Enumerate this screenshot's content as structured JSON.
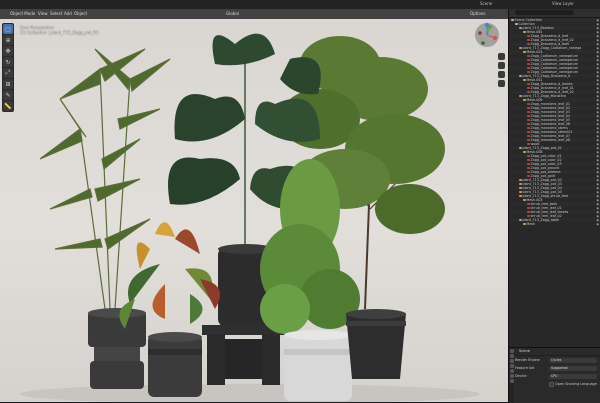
{
  "topbar": {
    "scene_label": "Scene",
    "view_layer_label": "View Layer"
  },
  "viewport": {
    "mode": "Object Mode",
    "menus": [
      "View",
      "Select",
      "Add",
      "Object"
    ],
    "transform": "Global",
    "options_label": "Options",
    "overlay_lines": [
      "User Perspective",
      "(1) Collection | plant_713_Zagg_pot_03"
    ],
    "gizmo_axes": {
      "x": "X",
      "y": "Y",
      "z": "Z"
    }
  },
  "outliner": {
    "search_placeholder": "",
    "rows": [
      {
        "text": "Scene Collection",
        "color": "#bbbbbb",
        "indent": 0
      },
      {
        "text": "Collection",
        "color": "#bbbbbb",
        "indent": 1
      },
      {
        "text": "plant_713_Bambus",
        "color": "#e0915c",
        "indent": 2
      },
      {
        "text": "Mesh.061",
        "color": "#8fc85a",
        "indent": 3
      },
      {
        "text": "Zagg_Dracaena_d_leaf",
        "color": "#c04040",
        "indent": 4
      },
      {
        "text": "Zagg_Dracaena_d_leaf_02",
        "color": "#c04040",
        "indent": 4
      },
      {
        "text": "Zagg_Dracaena_d_bark",
        "color": "#c04040",
        "indent": 4
      },
      {
        "text": "plant_713_Zagg_Codiaeum_variega",
        "color": "#e0915c",
        "indent": 2
      },
      {
        "text": "Mesh.024",
        "color": "#8fc85a",
        "indent": 3
      },
      {
        "text": "Zagg_Codiaeum_variegatum",
        "color": "#c04040",
        "indent": 4
      },
      {
        "text": "Zagg_Codiaeum_variegatum",
        "color": "#c04040",
        "indent": 4
      },
      {
        "text": "Zagg_Codiaeum_variegatum",
        "color": "#c04040",
        "indent": 4
      },
      {
        "text": "Zagg_Codiaeum_variegatum",
        "color": "#c04040",
        "indent": 4
      },
      {
        "text": "Zagg_Codiaeum_variegatum",
        "color": "#c04040",
        "indent": 4
      },
      {
        "text": "plant_713_Zagg_Dracaena_d",
        "color": "#e0915c",
        "indent": 2
      },
      {
        "text": "Mesh.052",
        "color": "#8fc85a",
        "indent": 3
      },
      {
        "text": "Zagg_Dracaena_d_leaves",
        "color": "#c04040",
        "indent": 4
      },
      {
        "text": "Zagg_Dracaena_d_leaf_01",
        "color": "#c04040",
        "indent": 4
      },
      {
        "text": "Zagg_Dracaena_d_leaf_02",
        "color": "#c04040",
        "indent": 4
      },
      {
        "text": "plant_713_Zagg_Monstera",
        "color": "#e0915c",
        "indent": 2
      },
      {
        "text": "Mesh.009",
        "color": "#8fc85a",
        "indent": 3
      },
      {
        "text": "Zagg_monstera_leaf_01",
        "color": "#c04040",
        "indent": 4
      },
      {
        "text": "Zagg_monstera_leaf_02",
        "color": "#c04040",
        "indent": 4
      },
      {
        "text": "Zagg_monstera_leaf_03",
        "color": "#c04040",
        "indent": 4
      },
      {
        "text": "Zagg_monstera_leaf_04",
        "color": "#c04040",
        "indent": 4
      },
      {
        "text": "Zagg_monstera_leaf_05",
        "color": "#c04040",
        "indent": 4
      },
      {
        "text": "Zagg_monstera_leaf_06",
        "color": "#c04040",
        "indent": 4
      },
      {
        "text": "Zagg_monstera_stems",
        "color": "#c04040",
        "indent": 4
      },
      {
        "text": "Zagg_monstera_stem001",
        "color": "#c04040",
        "indent": 4
      },
      {
        "text": "Zagg_monstera_leaf_07",
        "color": "#c04040",
        "indent": 4
      },
      {
        "text": "Zagg_monstera_leaf_08",
        "color": "#c04040",
        "indent": 4
      },
      {
        "text": "wood",
        "color": "#c04040",
        "indent": 4
      },
      {
        "text": "plant_713_Zagg_pot_01",
        "color": "#e0915c",
        "indent": 2
      },
      {
        "text": "Mesh.008",
        "color": "#8fc85a",
        "indent": 3
      },
      {
        "text": "Zagg_pot_color_01",
        "color": "#c04040",
        "indent": 4
      },
      {
        "text": "Zagg_pot_color_02",
        "color": "#c04040",
        "indent": 4
      },
      {
        "text": "Zagg_pot_color_03",
        "color": "#c04040",
        "indent": 4
      },
      {
        "text": "Zagg_pot_ground",
        "color": "#c04040",
        "indent": 4
      },
      {
        "text": "Zagg_pot_address",
        "color": "#c04040",
        "indent": 4
      },
      {
        "text": "Zagg_pot_gold",
        "color": "#c04040",
        "indent": 4
      },
      {
        "text": "plant_713_Zagg_pot_02",
        "color": "#e0915c",
        "indent": 2
      },
      {
        "text": "plant_713_Zagg_pot_03",
        "color": "#e0915c",
        "indent": 2
      },
      {
        "text": "plant_713_Zagg_pot_04",
        "color": "#e0915c",
        "indent": 2
      },
      {
        "text": "plant_713_Zagg_pot_05",
        "color": "#e0915c",
        "indent": 2
      },
      {
        "text": "plant_713_Zagg_shrub_tree",
        "color": "#e0915c",
        "indent": 2
      },
      {
        "text": "Mesh.003",
        "color": "#8fc85a",
        "indent": 3
      },
      {
        "text": "shrub_tree_bark",
        "color": "#c04040",
        "indent": 4
      },
      {
        "text": "shrub_tree_leaf_01",
        "color": "#c04040",
        "indent": 4
      },
      {
        "text": "shrub_tree_leaf_leaves",
        "color": "#c04040",
        "indent": 4
      },
      {
        "text": "shrub_tree_leaf_02",
        "color": "#c04040",
        "indent": 4
      },
      {
        "text": "plant_713_Zagg_table",
        "color": "#e0915c",
        "indent": 2
      },
      {
        "text": "Mesh",
        "color": "#8fc85a",
        "indent": 3
      }
    ]
  },
  "properties": {
    "title": "Scene",
    "render_engine_label": "Render Engine",
    "render_engine_value": "Cycles",
    "feature_set_label": "Feature Set",
    "feature_set_value": "Supported",
    "device_label": "Device",
    "device_value": "CPU",
    "osl_label": "Open Shading Language"
  }
}
